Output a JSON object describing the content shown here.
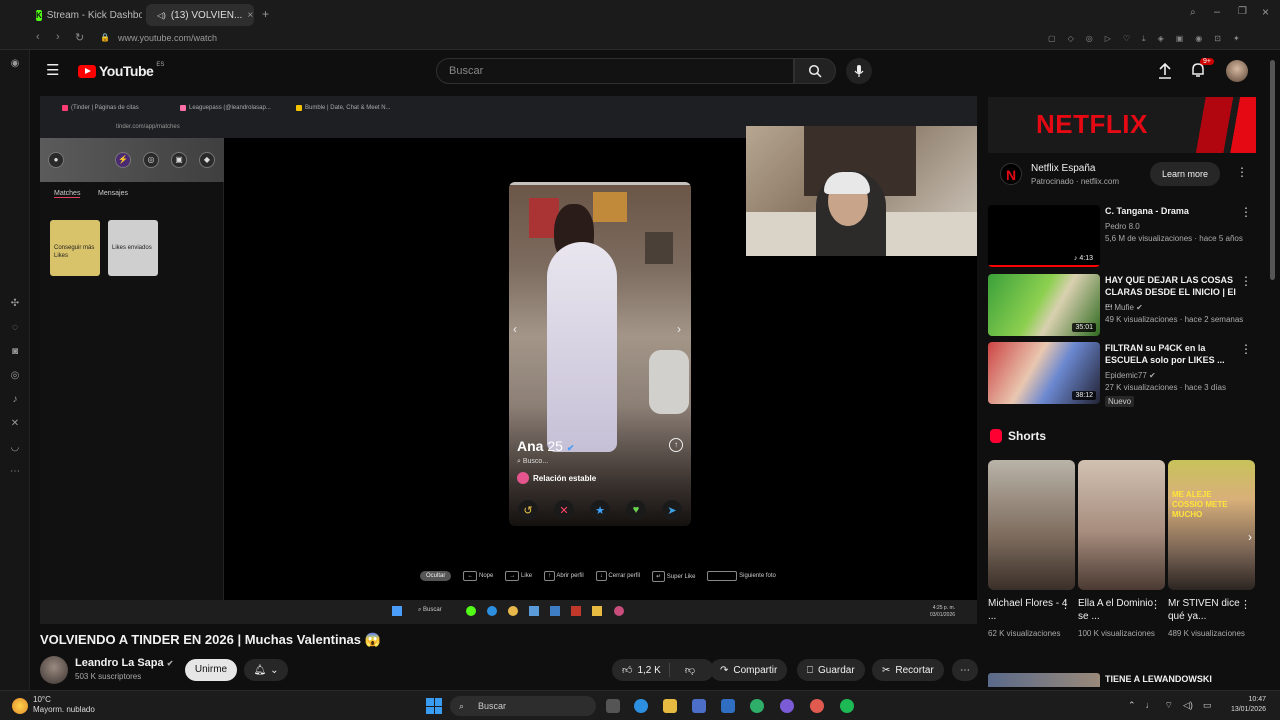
{
  "browser": {
    "tabs": [
      {
        "title": "Stream - Kick Dashboard"
      },
      {
        "title": "(13) VOLVIEN..."
      }
    ],
    "url": "www.youtube.com/watch"
  },
  "youtube": {
    "logo_text": "YouTube",
    "country": "ES",
    "search_placeholder": "Buscar",
    "notifications_badge": "9+"
  },
  "stream": {
    "inner_tabs": [
      {
        "title": "(Tinder | Páginas de citas"
      },
      {
        "title": "Leaguepass (@leandrolasap..."
      },
      {
        "title": "Bumble | Date, Chat & Meet N..."
      }
    ],
    "inner_url": "tinder.com/app/matches",
    "sidebar": {
      "tabs": [
        "Matches",
        "Mensajes"
      ],
      "cards": [
        {
          "label": "Conseguir más Likes",
          "color": "#d9c36a"
        },
        {
          "label": "Likes enviados",
          "color": "#cfcfcf"
        }
      ]
    },
    "profile": {
      "name": "Ana",
      "age": "25",
      "busco": "Busco...",
      "relationship": "Relación estable"
    },
    "hints": {
      "ocultar": "Ocultar",
      "items": [
        "Nope",
        "Like",
        "Abrir perfil",
        "Cerrar perfil",
        "Super Like",
        "Siguiente foto"
      ]
    },
    "inner_taskbar": {
      "search": "Buscar",
      "clock_time": "4:25 p. m.",
      "clock_date": "03/01/2026"
    }
  },
  "video": {
    "title": "VOLVIENDO A TINDER EN 2026 | Muchas Valentinas",
    "emoji": "😱",
    "channel": "Leandro La Sapa",
    "subscribers": "503 K suscriptores",
    "join_label": "Unirme",
    "likes": "1,2 K",
    "share_label": "Compartir",
    "save_label": "Guardar",
    "clip_label": "Recortar"
  },
  "ad": {
    "banner_text": "NETFLIX",
    "advertiser": "Netflix España",
    "sponsored": "Patrocinado",
    "domain": "netflix.com",
    "cta": "Learn more"
  },
  "recommendations": [
    {
      "title": "C. Tangana - Drama",
      "channel": "Pedro 8.0",
      "meta": "5,6 M de visualizaciones · hace 5 años",
      "duration": "4:13",
      "badge": ""
    },
    {
      "title": "HAY QUE DEJAR LAS COSAS CLARAS DESDE EL INICIO | El ...",
      "channel": "El Mufie",
      "meta": "49 K visualizaciones · hace 2 semanas",
      "duration": "35:01",
      "badge": ""
    },
    {
      "title": "FILTRAN su P4CK en la ESCUELA solo por LIKES ...",
      "channel": "Epidemic77",
      "meta": "27 K visualizaciones · hace 3 días",
      "duration": "38:12",
      "badge": "Nuevo"
    }
  ],
  "shorts": {
    "heading": "Shorts",
    "items": [
      {
        "title": "Michael Flores - 4 ...",
        "views": "62 K visualizaciones"
      },
      {
        "title": "Ella A el Dominio se ...",
        "views": "100 K visualizaciones"
      },
      {
        "title": "Mr STIVEN dice qué ya...",
        "views": "489 K visualizaciones"
      }
    ]
  },
  "next_rec_title": "TIENE A LEWANDOWSKI",
  "taskbar": {
    "weather_temp": "10°C",
    "weather_desc": "Mayorm. nublado",
    "search": "Buscar",
    "time": "10:47",
    "date": "13/01/2026"
  }
}
